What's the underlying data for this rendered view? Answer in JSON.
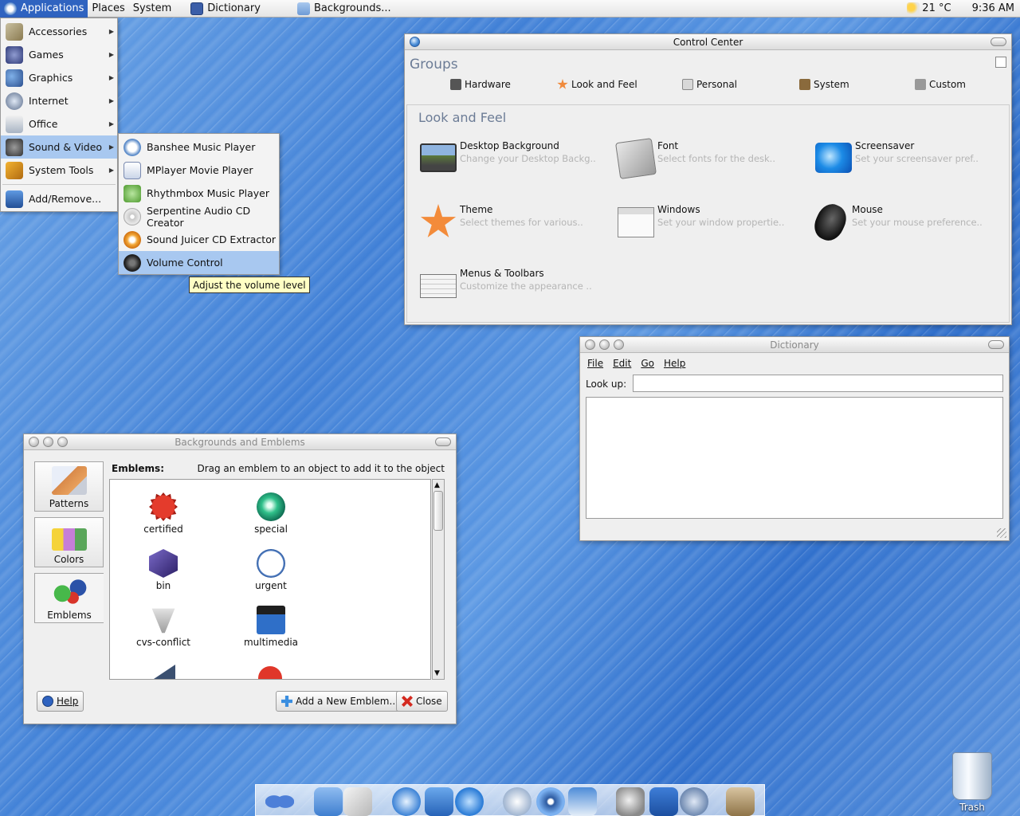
{
  "top_panel": {
    "applications": "Applications",
    "places": "Places",
    "system": "System",
    "task_dictionary": "Dictionary",
    "task_backgrounds": "Backgrounds...",
    "weather": "21 °C",
    "clock": "9:36 AM"
  },
  "applications_menu": [
    {
      "label": "Accessories",
      "icon": "accessories-icon"
    },
    {
      "label": "Games",
      "icon": "games-icon"
    },
    {
      "label": "Graphics",
      "icon": "graphics-icon"
    },
    {
      "label": "Internet",
      "icon": "internet-icon"
    },
    {
      "label": "Office",
      "icon": "office-icon"
    },
    {
      "label": "Sound & Video",
      "icon": "sound-video-icon"
    },
    {
      "label": "System Tools",
      "icon": "system-tools-icon"
    },
    {
      "label": "Add/Remove...",
      "icon": "add-remove-icon"
    }
  ],
  "sound_video_menu": [
    {
      "label": "Banshee Music Player"
    },
    {
      "label": "MPlayer Movie Player"
    },
    {
      "label": "Rhythmbox Music Player"
    },
    {
      "label": "Serpentine Audio CD Creator"
    },
    {
      "label": "Sound Juicer CD Extractor"
    },
    {
      "label": "Volume Control"
    }
  ],
  "tooltip": "Adjust the volume level",
  "control_center": {
    "title": "Control Center",
    "groups_title": "Groups",
    "groups": [
      "Hardware",
      "Look and Feel",
      "Personal",
      "System",
      "Custom"
    ],
    "section_title": "Look and Feel",
    "items": [
      {
        "name": "Desktop Background",
        "desc": "Change your Desktop Backg.."
      },
      {
        "name": "Font",
        "desc": "Select fonts for the desk.."
      },
      {
        "name": "Screensaver",
        "desc": "Set your screensaver pref.."
      },
      {
        "name": "Theme",
        "desc": "Select themes for various.."
      },
      {
        "name": "Windows",
        "desc": "Set your window propertie.."
      },
      {
        "name": "Mouse",
        "desc": "Set your mouse preference.."
      },
      {
        "name": "Menus & Toolbars",
        "desc": "Customize the appearance .."
      }
    ]
  },
  "dictionary": {
    "title": "Dictionary",
    "menu": [
      "File",
      "Edit",
      "Go",
      "Help"
    ],
    "lookup_label": "Look up:",
    "lookup_value": ""
  },
  "backgrounds": {
    "title": "Backgrounds and Emblems",
    "tabs": [
      "Patterns",
      "Colors",
      "Emblems"
    ],
    "emblems_label": "Emblems:",
    "hint": "Drag an emblem to an object to add it to the object",
    "emblems": [
      "certified",
      "special",
      "bin",
      "urgent",
      "cvs-conflict",
      "multimedia"
    ],
    "help_button": "Help",
    "add_button": "Add a New Emblem...",
    "close_button": "Close"
  },
  "trash_label": "Trash",
  "colors": {
    "panel_active": "#2f63c0",
    "menu_highlight": "#a8c8f0",
    "tooltip_bg": "#ffffc4",
    "section_title": "#6c7c96"
  }
}
